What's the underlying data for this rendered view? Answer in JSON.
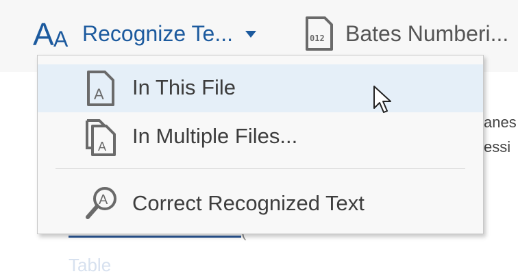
{
  "toolbar": {
    "recognize_label": "Recognize Te...",
    "bates_label": "Bates Numberi..."
  },
  "menu": {
    "items": [
      {
        "label": "In This File",
        "icon": "document-a-icon",
        "highlighted": true
      },
      {
        "label": "In Multiple Files...",
        "icon": "multiple-documents-a-icon"
      },
      {
        "label": "Correct Recognized Text",
        "icon": "magnify-a-icon"
      }
    ]
  },
  "background": {
    "right_fragment_1": "anes",
    "right_fragment_2": "essi",
    "faded_text": "Table",
    "paren_fragment": "("
  },
  "colors": {
    "accent_blue": "#1c5a9e",
    "menu_highlight": "#e5eff8",
    "menu_bg": "#f8f8f8",
    "toolbar_bg": "#f7f7f7"
  }
}
